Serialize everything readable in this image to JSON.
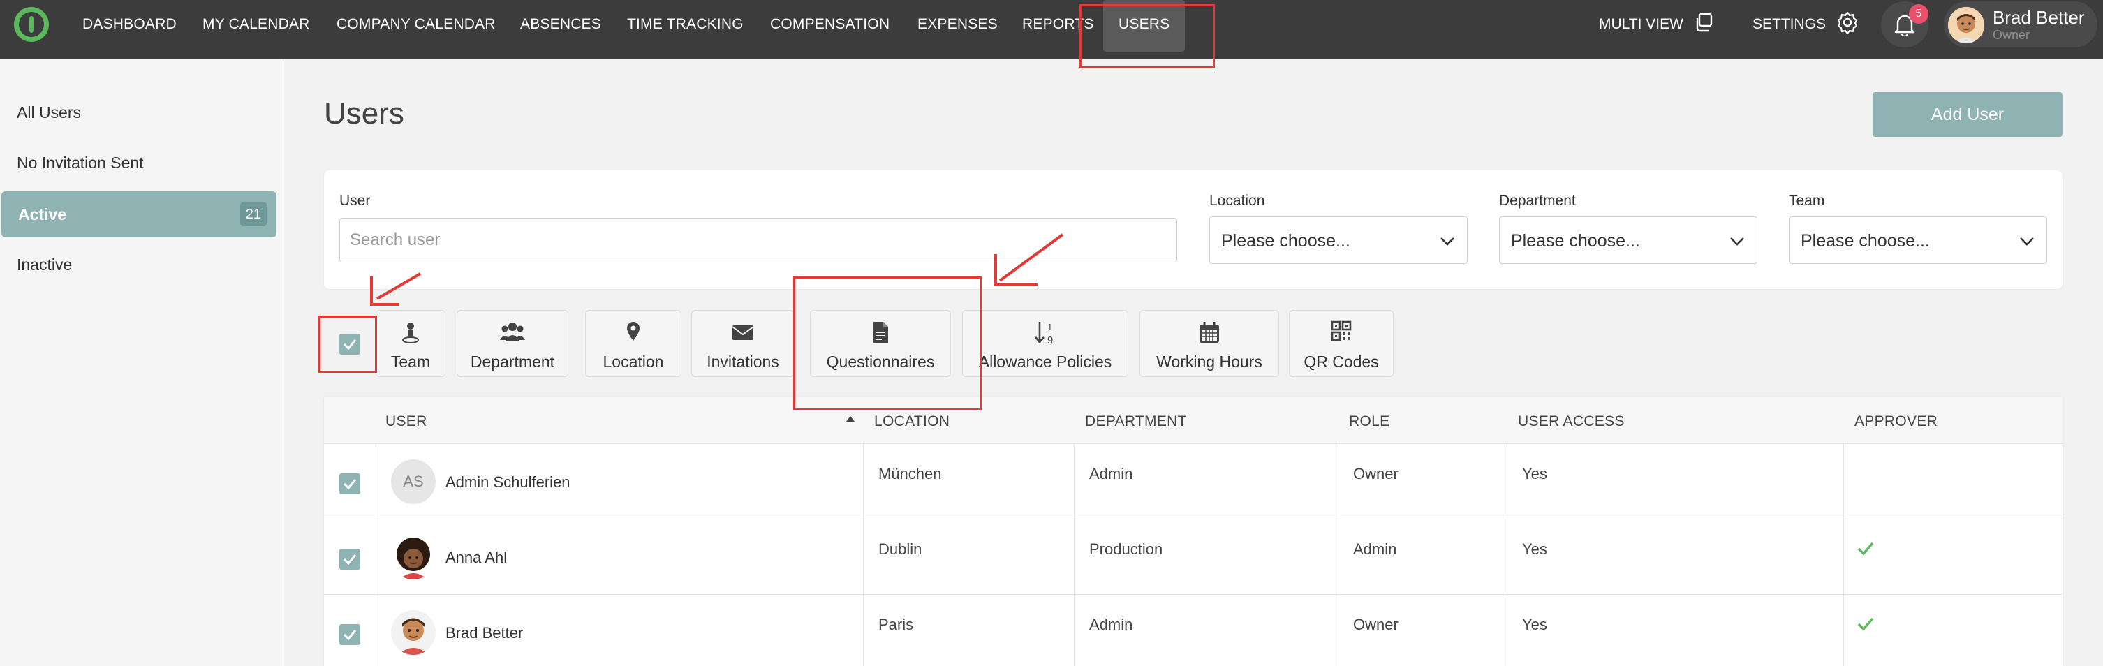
{
  "nav": {
    "items": [
      "DASHBOARD",
      "MY CALENDAR",
      "COMPANY CALENDAR",
      "ABSENCES",
      "TIME TRACKING",
      "COMPENSATION",
      "EXPENSES",
      "REPORTS",
      "USERS"
    ],
    "active": "USERS",
    "multi_view": "MULTI VIEW",
    "settings": "SETTINGS",
    "notification_count": "5",
    "user_name": "Brad Better",
    "user_role": "Owner"
  },
  "sidebar": {
    "items": [
      {
        "label": "All Users"
      },
      {
        "label": "No Invitation Sent"
      },
      {
        "label": "Active",
        "count": "21"
      },
      {
        "label": "Inactive"
      }
    ]
  },
  "page": {
    "title": "Users",
    "add_user_label": "Add User"
  },
  "filters": {
    "user_label": "User",
    "search_placeholder": "Search user",
    "search_value": "",
    "location_label": "Location",
    "location_value": "Please choose...",
    "department_label": "Department",
    "department_value": "Please choose...",
    "team_label": "Team",
    "team_value": "Please choose..."
  },
  "toolbar": {
    "buttons": [
      {
        "label": "Team",
        "icon": "person-icon"
      },
      {
        "label": "Department",
        "icon": "group-icon"
      },
      {
        "label": "Location",
        "icon": "map-pin-icon"
      },
      {
        "label": "Invitations",
        "icon": "envelope-icon"
      },
      {
        "label": "Questionnaires",
        "icon": "document-icon"
      },
      {
        "label": "Allowance Policies",
        "icon": "sort-numeric-icon"
      },
      {
        "label": "Working Hours",
        "icon": "calendar-icon"
      },
      {
        "label": "QR Codes",
        "icon": "qr-code-icon"
      }
    ]
  },
  "table": {
    "headers": [
      "USER",
      "LOCATION",
      "DEPARTMENT",
      "ROLE",
      "USER ACCESS",
      "APPROVER"
    ],
    "rows": [
      {
        "initials": "AS",
        "name": "Admin Schulferien",
        "location": "München",
        "department": "Admin",
        "role": "Owner",
        "access": "Yes",
        "approver": false
      },
      {
        "initials": "",
        "name": "Anna Ahl",
        "location": "Dublin",
        "department": "Production",
        "role": "Admin",
        "access": "Yes",
        "approver": true
      },
      {
        "initials": "",
        "name": "Brad Better",
        "location": "Paris",
        "department": "Admin",
        "role": "Owner",
        "access": "Yes",
        "approver": true
      }
    ]
  },
  "colors": {
    "topbar": "#3c3c3c",
    "accent": "#8fb3b3",
    "logo": "#5cb85c",
    "badge": "#e8506b",
    "annotation": "#e53935",
    "approver_check": "#5cb85c"
  }
}
